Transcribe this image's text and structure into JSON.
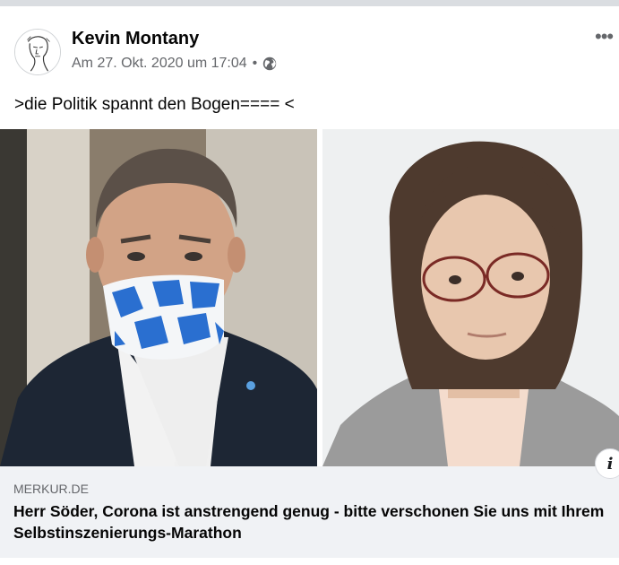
{
  "post": {
    "author": "Kevin Montany",
    "timestamp": "Am 27. Okt. 2020 um 17:04",
    "separator": "•",
    "privacy_icon": "globe-icon",
    "text": ">die Politik spannt den Bogen==== <",
    "more_label": "•••"
  },
  "link_preview": {
    "domain": "MERKUR.DE",
    "headline": "Herr Söder, Corona ist anstrengend genug - bitte verschonen Sie uns mit Ihrem Selbstinszenierungs-Marathon",
    "info_icon_label": "i"
  },
  "colors": {
    "text_primary": "#050505",
    "text_secondary": "#65676b",
    "link_bg": "#f0f2f5",
    "mask_blue": "#2a6fd0"
  }
}
